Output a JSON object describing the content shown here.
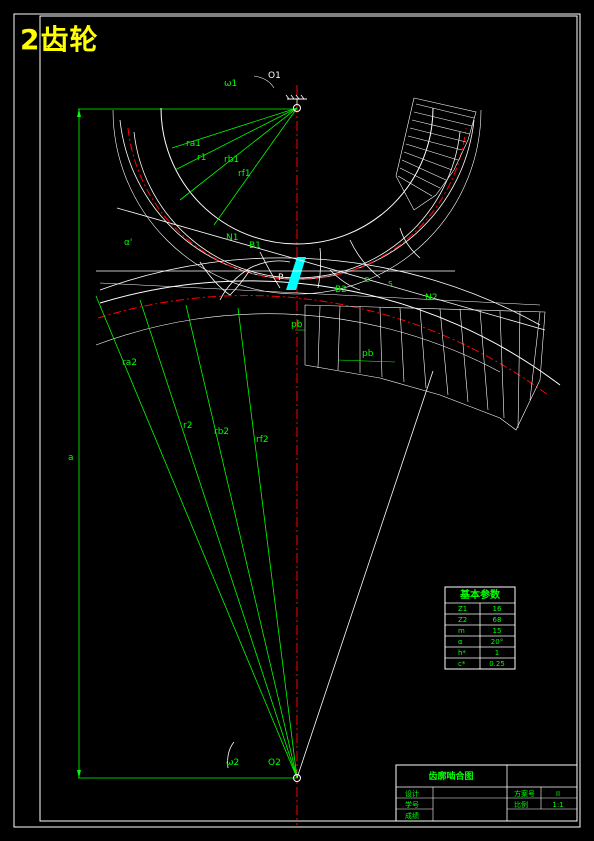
{
  "title": "2齿轮",
  "labels": {
    "o1": "O1",
    "o2": "O2",
    "omega1": "ω1",
    "omega2": "ω2",
    "ra1": "ra1",
    "r1": "r1",
    "rb1": "rb1",
    "rf1": "rf1",
    "ra2": "ra2",
    "r2": "r2",
    "rb2": "rb2",
    "rf2": "rf2",
    "alpha": "α'",
    "a": "a",
    "n1": "N1",
    "n2": "N2",
    "b1": "B1",
    "b2": "B2",
    "p": "P",
    "pb": "pb",
    "pb2": "pb",
    "e": "e",
    "s": "s"
  },
  "params_table": {
    "title": "基本参数",
    "rows": [
      {
        "name": "Z1",
        "value": "16"
      },
      {
        "name": "Z2",
        "value": "68"
      },
      {
        "name": "m",
        "value": "15"
      },
      {
        "name": "α",
        "value": "20°"
      },
      {
        "name": "h*",
        "value": "1"
      },
      {
        "name": "c*",
        "value": "0.25"
      }
    ]
  },
  "title_block": {
    "title": "齿廓啮合图",
    "left_rows": [
      "设计",
      "学号",
      "成绩"
    ],
    "right_rows": [
      {
        "label": "方案号",
        "value": "II"
      },
      {
        "label": "比例",
        "value": "1:1"
      }
    ]
  },
  "colors": {
    "background": "#000000",
    "border": "#ffffff",
    "construction": "#00ff00",
    "pitch_circle": "#ff0000",
    "highlight": "#00ffff",
    "title": "#ffff00"
  }
}
